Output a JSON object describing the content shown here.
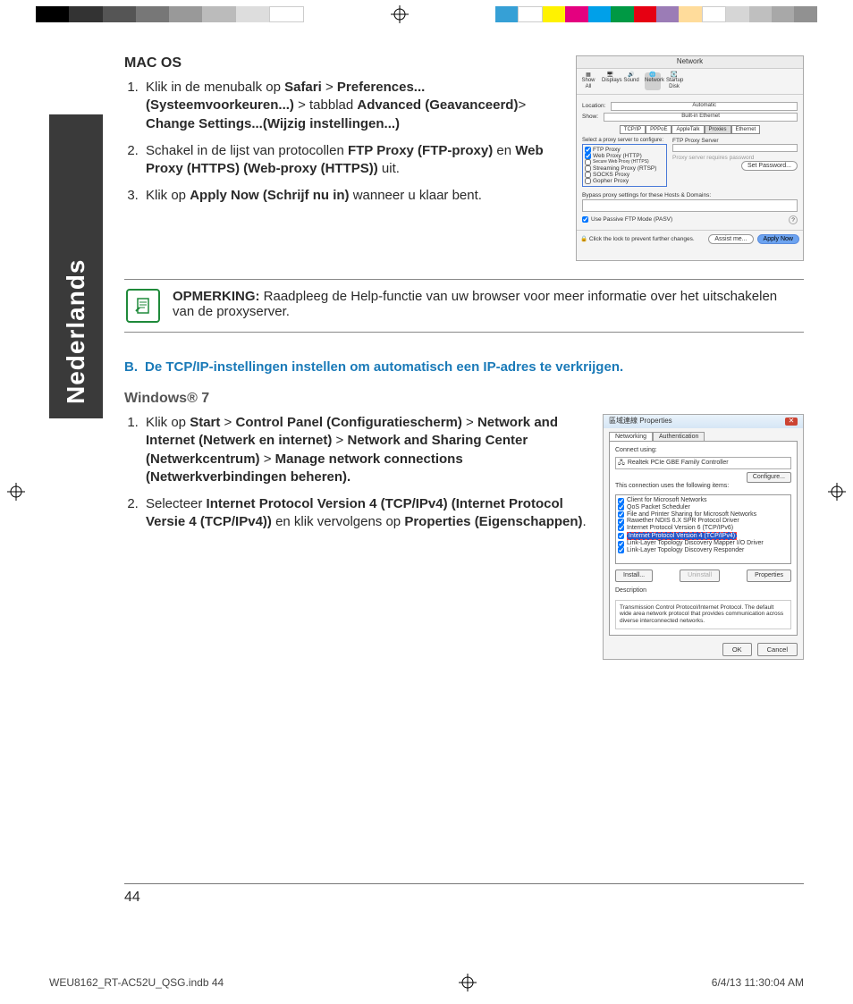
{
  "colorbar": [
    "#000000",
    "#333333",
    "#555555",
    "#777777",
    "#999999",
    "#bbbbbb",
    "#dddddd",
    "#ffffff",
    "#ffffff",
    "#36a0d6",
    "#ffffff",
    "#fff200",
    "#e4007f",
    "#00a0e9",
    "#009944",
    "#e60012",
    "#9b7cb6",
    "#ffdc9b",
    "#ffffff",
    "#d6d6d6",
    "#bfbfbf",
    "#a8a8a8",
    "#919191",
    "#7a7a7a"
  ],
  "side_label": "Nederlands",
  "macos": {
    "title": "MAC OS",
    "steps": {
      "s1_a": "Klik in de menubalk op ",
      "s1_b": "Safari",
      "s1_c": " > ",
      "s1_d": "Preferences... (Systeemvoorkeuren...)",
      "s1_e": " > tabblad ",
      "s1_f": "Advanced (Geavanceerd)",
      "s1_g": "> ",
      "s1_h": "Change  Settings...(Wijzig instellingen...)",
      "s2_a": "Schakel in de lijst van protocollen ",
      "s2_b": "FTP Proxy (FTP-proxy)",
      "s2_c": " en ",
      "s2_d": "Web Proxy (HTTPS) (Web-proxy (HTTPS))",
      "s2_e": " uit.",
      "s3_a": "Klik op ",
      "s3_b": "Apply Now (Schrijf nu in)",
      "s3_c": " wanneer u klaar bent."
    }
  },
  "mac_screenshot": {
    "window_title": "Network",
    "icons": [
      "Show All",
      "Displays",
      "Sound",
      "Network",
      "Startup Disk"
    ],
    "loc_label": "Location:",
    "loc_value": "Automatic",
    "show_label": "Show:",
    "show_value": "Built-in Ethernet",
    "tabs": [
      "TCP/IP",
      "PPPoE",
      "AppleTalk",
      "Proxies",
      "Ethernet"
    ],
    "select_label": "Select a proxy server to configure:",
    "ftp_label": "FTP Proxy Server",
    "protocols": [
      "FTP Proxy",
      "Web Proxy (HTTP)",
      "Secure Web Proxy (HTTPS)",
      "Streaming Proxy (RTSP)",
      "SOCKS Proxy",
      "Gopher Proxy"
    ],
    "pwd_text": "Proxy server requires password",
    "setpwd": "Set Password...",
    "bypass": "Bypass proxy settings for these Hosts & Domains:",
    "pasv": "Use Passive FTP Mode (PASV)",
    "lock": "Click the lock to prevent further changes.",
    "assist": "Assist me...",
    "apply": "Apply Now"
  },
  "note": {
    "label": "OPMERKING:",
    "text": "   Raadpleeg de Help-functie van uw browser voor meer informatie over het uitschakelen van de proxyserver."
  },
  "section_b": {
    "prefix": "B.",
    "title": "De TCP/IP-instellingen instellen om automatisch een IP-adres te verkrijgen."
  },
  "win7": {
    "title": "Windows® 7",
    "s1_a": "Klik op  ",
    "s1_b": "Start",
    "s1_c": " > ",
    "s1_d": "Control Panel (Configuratiescherm)",
    "s1_e": " > ",
    "s1_f": "Network and Internet (Netwerk en internet)",
    "s1_g": " > ",
    "s1_h": "Network and Sharing Center (Netwerkcentrum)",
    "s1_i": " > ",
    "s1_j": "Manage network connections (Netwerkverbindingen beheren).",
    "s2_a": "Selecteer ",
    "s2_b": "Internet Protocol Version 4 (TCP/IPv4) (Internet Protocol Versie 4 (TCP/IPv4))",
    "s2_c": " en klik vervolgens op ",
    "s2_d": "Properties (Eigenschappen)",
    "s2_e": "."
  },
  "win_screenshot": {
    "title": "區域連線 Properties",
    "tabs": [
      "Networking",
      "Authentication"
    ],
    "connect_using": "Connect using:",
    "adapter": "Realtek PCIe GBE Family Controller",
    "configure": "Configure...",
    "uses_label": "This connection uses the following items:",
    "items": [
      "Client for Microsoft Networks",
      "QoS Packet Scheduler",
      "File and Printer Sharing for Microsoft Networks",
      "Rawether NDIS 6.X SPR Protocol Driver",
      "Internet Protocol Version 6 (TCP/IPv6)",
      "Internet Protocol Version 4 (TCP/IPv4)",
      "Link-Layer Topology Discovery Mapper I/O Driver",
      "Link-Layer Topology Discovery Responder"
    ],
    "install": "Install...",
    "uninstall": "Uninstall",
    "properties": "Properties",
    "desc_label": "Description",
    "desc_text": "Transmission Control Protocol/Internet Protocol. The default wide area network protocol that provides communication across diverse interconnected networks.",
    "ok": "OK",
    "cancel": "Cancel"
  },
  "page_number": "44",
  "footer": {
    "file": "WEU8162_RT-AC52U_QSG.indb   44",
    "date": "6/4/13   11:30:04 AM"
  }
}
